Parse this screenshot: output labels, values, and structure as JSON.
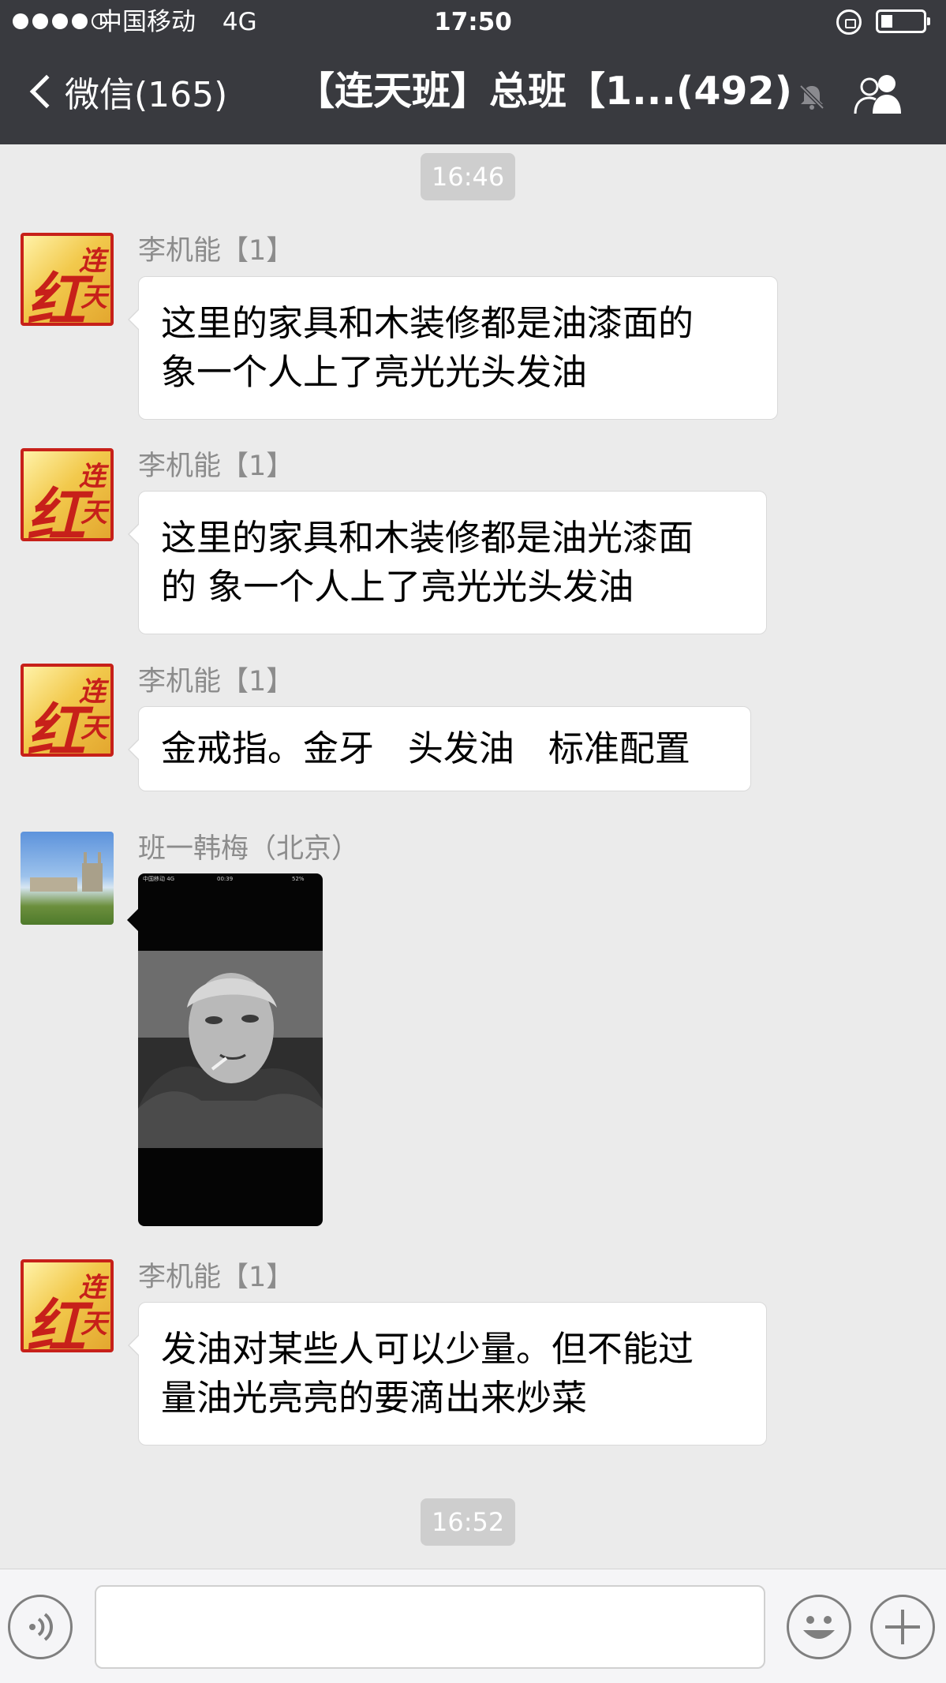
{
  "status_bar": {
    "carrier": "中国移动",
    "network": "4G",
    "time": "17:50",
    "signal_bars_filled": 4,
    "signal_bars_total": 5
  },
  "nav": {
    "back_label": "微信(165)",
    "title": "【连天班】总班【1...(492)",
    "mute_icon": "mute-bell-icon",
    "members_icon": "group-members-icon"
  },
  "chat": {
    "timestamps": [
      "16:46",
      "16:52"
    ],
    "messages": [
      {
        "sender": "李机能【1】",
        "avatar": "red-calligraphy-seal",
        "lines": [
          "这里的家具和木装修都是油漆面的",
          "象一个人上了亮光光头发油"
        ]
      },
      {
        "sender": "李机能【1】",
        "avatar": "red-calligraphy-seal",
        "lines": [
          "这里的家具和木装修都是油光漆面",
          "的 象一个人上了亮光光头发油"
        ]
      },
      {
        "sender": "李机能【1】",
        "avatar": "red-calligraphy-seal",
        "lines": [
          "金戒指。金牙   头发油   标准配置"
        ]
      },
      {
        "sender": "班一韩梅（北京）",
        "avatar": "building-landscape-photo",
        "image": {
          "type": "screenshot-photo",
          "status_carrier": "中国移动  4G",
          "status_time": "00:39",
          "status_battery": "52%"
        }
      },
      {
        "sender": "李机能【1】",
        "avatar": "red-calligraphy-seal",
        "lines": [
          "发油对某些人可以少量。但不能过",
          "量油光亮亮的要滴出来炒菜"
        ]
      }
    ]
  },
  "avatar_seal": {
    "chars": [
      "红",
      "连",
      "天"
    ]
  },
  "input_bar": {
    "voice_icon": "voice-input-icon",
    "emoji_icon": "emoji-icon",
    "plus_icon": "plus-icon",
    "placeholder": ""
  },
  "colors": {
    "nav_bg": "#393a3f",
    "chat_bg": "#ebebeb",
    "bubble_bg": "#ffffff",
    "sender_text": "#8c8c8c",
    "seal_red": "#c7201a"
  }
}
